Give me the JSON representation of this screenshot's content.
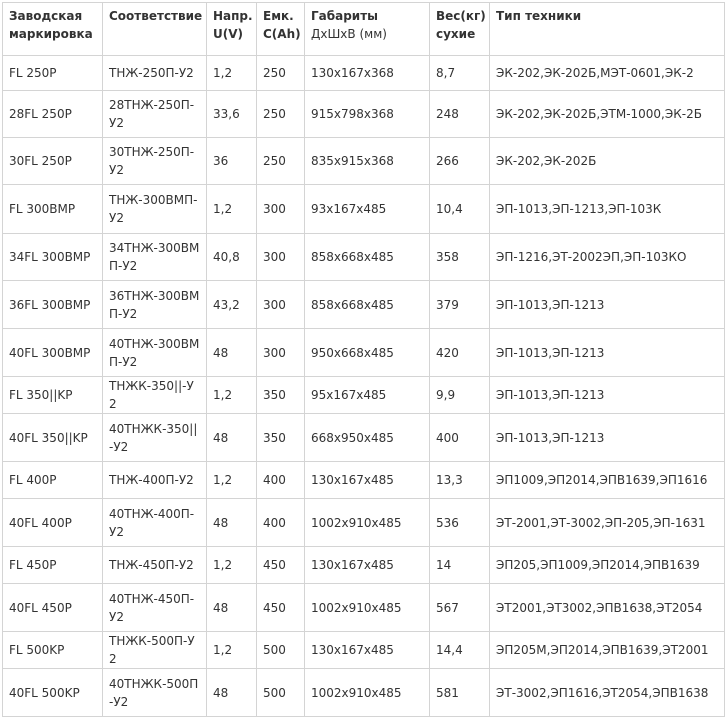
{
  "header": {
    "c1_l1": "Заводская",
    "c1_l2": "маркировка",
    "c2": "Соответствие",
    "c3_l1": "Напр.",
    "c3_l2": "U(V)",
    "c4_l1": "Емк.",
    "c4_l2": "C(Ah)",
    "c5_bold": "Габариты",
    "c5_light": "ДхШхВ (мм)",
    "c6_l1": "Вес(кг)",
    "c6_l2": "сухие",
    "c7": "Тип техники"
  },
  "rows": [
    {
      "marking": "FL 250P",
      "match": "ТНЖ-250П-У2",
      "voltage": "1,2",
      "capacity": "250",
      "dims": "130х167х368",
      "weight": "8,7",
      "equipment": "ЭК-202,ЭК-202Б,МЭТ-0601,ЭК-2"
    },
    {
      "marking": "28FL 250P",
      "match": "28ТНЖ-250П-У2",
      "voltage": "33,6",
      "capacity": "250",
      "dims": "915х798х368",
      "weight": "248",
      "equipment": "ЭК-202,ЭК-202Б,ЭТМ-1000,ЭК-2Б"
    },
    {
      "marking": "30FL 250P",
      "match": "30ТНЖ-250П-У2",
      "voltage": "36",
      "capacity": "250",
      "dims": "835х915х368",
      "weight": "266",
      "equipment": "ЭК-202,ЭК-202Б"
    },
    {
      "marking": "FL 300BMP",
      "match": "ТНЖ-300ВМП-У2",
      "voltage": "1,2",
      "capacity": "300",
      "dims": "93х167х485",
      "weight": "10,4",
      "equipment": "ЭП-1013,ЭП-1213,ЭП-103К"
    },
    {
      "marking": "34FL 300BMP",
      "match": "34ТНЖ-300ВМП-У2",
      "voltage": "40,8",
      "capacity": "300",
      "dims": "858х668х485",
      "weight": "358",
      "equipment": "ЭП-1216,ЭТ-2002ЭП,ЭП-103КО"
    },
    {
      "marking": "36FL 300BMP",
      "match": "36ТНЖ-300ВМП-У2",
      "voltage": "43,2",
      "capacity": "300",
      "dims": "858х668х485",
      "weight": "379",
      "equipment": "ЭП-1013,ЭП-1213"
    },
    {
      "marking": "40FL 300BMP",
      "match": "40ТНЖ-300ВМП-У2",
      "voltage": "48",
      "capacity": "300",
      "dims": "950х668х485",
      "weight": "420",
      "equipment": "ЭП-1013,ЭП-1213"
    },
    {
      "marking": "FL 350||KP",
      "match": "ТНЖК-350||-У2",
      "voltage": "1,2",
      "capacity": "350",
      "dims": "95х167х485",
      "weight": "9,9",
      "equipment": "ЭП-1013,ЭП-1213"
    },
    {
      "marking": "40FL 350||KP",
      "match": "40ТНЖК-350||-У2",
      "voltage": "48",
      "capacity": "350",
      "dims": "668х950х485",
      "weight": "400",
      "equipment": "ЭП-1013,ЭП-1213"
    },
    {
      "marking": "FL 400P",
      "match": "ТНЖ-400П-У2",
      "voltage": "1,2",
      "capacity": "400",
      "dims": "130х167х485",
      "weight": "13,3",
      "equipment": "ЭП1009,ЭП2014,ЭПВ1639,ЭП1616"
    },
    {
      "marking": "40FL 400P",
      "match": "40ТНЖ-400П-У2",
      "voltage": "48",
      "capacity": "400",
      "dims": "1002х910х485",
      "weight": "536",
      "equipment": "ЭТ-2001,ЭТ-3002,ЭП-205,ЭП-1631"
    },
    {
      "marking": "FL 450P",
      "match": "ТНЖ-450П-У2",
      "voltage": "1,2",
      "capacity": "450",
      "dims": "130х167х485",
      "weight": "14",
      "equipment": "ЭП205,ЭП1009,ЭП2014,ЭПВ1639"
    },
    {
      "marking": "40FL 450P",
      "match": "40ТНЖ-450П-У2",
      "voltage": "48",
      "capacity": "450",
      "dims": "1002х910х485",
      "weight": "567",
      "equipment": "ЭТ2001,ЭТ3002,ЭПВ1638,ЭТ2054"
    },
    {
      "marking": "FL 500KP",
      "match": "ТНЖК-500П-У2",
      "voltage": "1,2",
      "capacity": "500",
      "dims": "130х167х485",
      "weight": "14,4",
      "equipment": "ЭП205М,ЭП2014,ЭПВ1639,ЭТ2001"
    },
    {
      "marking": "40FL 500KP",
      "match": "40ТНЖК-500П-У2",
      "voltage": "48",
      "capacity": "500",
      "dims": "1002х910х485",
      "weight": "581",
      "equipment": "ЭТ-3002,ЭП1616,ЭТ2054,ЭПВ1638"
    }
  ]
}
